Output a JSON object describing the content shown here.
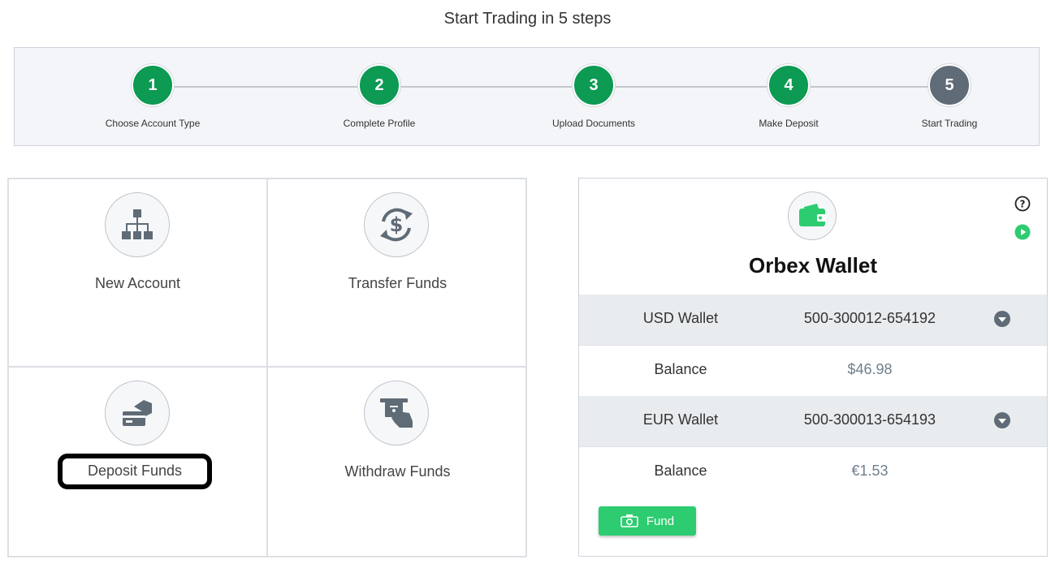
{
  "header": {
    "title": "Start Trading in 5 steps"
  },
  "steps": [
    {
      "number": "1",
      "label": "Choose Account Type",
      "status": "done"
    },
    {
      "number": "2",
      "label": "Complete Profile",
      "status": "done"
    },
    {
      "number": "3",
      "label": "Upload Documents",
      "status": "done"
    },
    {
      "number": "4",
      "label": "Make Deposit",
      "status": "done"
    },
    {
      "number": "5",
      "label": "Start Trading",
      "status": "pending"
    }
  ],
  "actions": {
    "new_account": {
      "label": "New Account",
      "icon": "sitemap-icon"
    },
    "transfer_funds": {
      "label": "Transfer Funds",
      "icon": "dollar-exchange-icon"
    },
    "deposit_funds": {
      "label": "Deposit Funds",
      "icon": "card-deposit-icon"
    },
    "withdraw_funds": {
      "label": "Withdraw Funds",
      "icon": "atm-withdraw-icon"
    }
  },
  "wallet": {
    "title": "Orbex Wallet",
    "accounts": [
      {
        "name": "USD Wallet",
        "number": "500-300012-654192",
        "balance_label": "Balance",
        "balance": "$46.98"
      },
      {
        "name": "EUR Wallet",
        "number": "500-300013-654193",
        "balance_label": "Balance",
        "balance": "€1.53"
      }
    ],
    "fund_label": "Fund"
  },
  "colors": {
    "step_done": "#0d9a53",
    "step_pending": "#5f6b76",
    "fund_button": "#2ecc71",
    "icon_gray": "#5f6b76"
  }
}
